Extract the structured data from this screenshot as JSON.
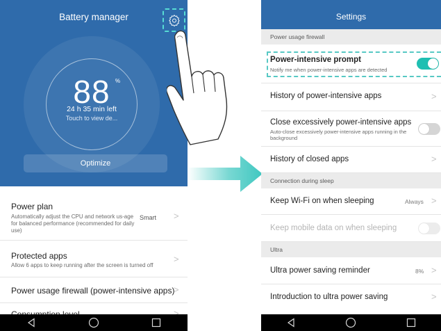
{
  "left": {
    "title": "Battery manager",
    "battery_value": "88",
    "battery_unit": "%",
    "time_left": "24 h 35 min left",
    "touch_hint": "Touch to view de...",
    "optimize_label": "Optimize",
    "items": [
      {
        "title": "Power plan",
        "subtitle": "Automatically adjust the CPU and network us-age for balanced performance (recommended for daily use)",
        "value": "Smart"
      },
      {
        "title": "Protected apps",
        "subtitle": "Allow 6 apps to keep running after the screen is turned off"
      },
      {
        "title": "Power usage firewall (power-intensive apps)"
      },
      {
        "title": "Consumption level"
      }
    ]
  },
  "right": {
    "title": "Settings",
    "sections": {
      "firewall": "Power usage firewall",
      "sleep": "Connection during sleep",
      "ultra": "Ultra"
    },
    "items": {
      "prompt": {
        "title": "Power-intensive prompt",
        "subtitle": "Notify me when power-intensive apps are detected",
        "on": true
      },
      "history_power": {
        "title": "History of power-intensive apps"
      },
      "close_excess": {
        "title": "Close excessively power-intensive apps",
        "subtitle": "Auto-close excessively power-intensive apps running in the background",
        "on": false
      },
      "history_closed": {
        "title": "History of closed apps"
      },
      "wifi_sleep": {
        "title": "Keep Wi-Fi on when sleeping",
        "value": "Always"
      },
      "mobile_data_sleep": {
        "title": "Keep mobile data on when sleeping",
        "on": false,
        "disabled": true
      },
      "ultra_reminder": {
        "title": "Ultra power saving reminder",
        "value": "8%"
      },
      "ultra_intro": {
        "title": "Introduction to ultra power saving"
      }
    }
  },
  "colors": {
    "header_blue": "#2f6bab",
    "toggle_on": "#1fbfb2",
    "highlight_dash": "#57dcd4",
    "arrow_teal": "#3fc7c0"
  },
  "icons": {
    "gear": "gear-icon",
    "back": "back-triangle-icon",
    "home": "home-circle-icon",
    "recents": "recents-square-icon",
    "chevron": "chevron-right-icon"
  }
}
